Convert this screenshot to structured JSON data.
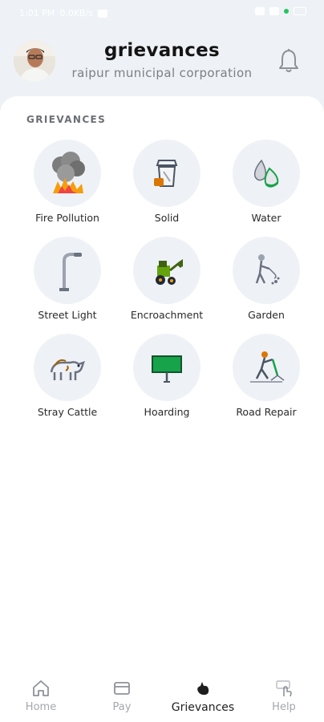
{
  "status_bar": {
    "time": "1:01 PM",
    "carrier": "0.0KB/s"
  },
  "header": {
    "title": "grievances",
    "subtitle": "raipur municipal corporation",
    "bell_icon": "bell-icon",
    "avatar": "user-avatar"
  },
  "section": {
    "title": "GRIEVANCES"
  },
  "categories": [
    {
      "label": "Fire Pollution",
      "icon": "fire-pollution-icon"
    },
    {
      "label": "Solid",
      "icon": "solid-waste-icon"
    },
    {
      "label": "Water",
      "icon": "water-icon"
    },
    {
      "label": "Street Light",
      "icon": "street-light-icon"
    },
    {
      "label": "Encroachment",
      "icon": "encroachment-icon"
    },
    {
      "label": "Garden",
      "icon": "garden-icon"
    },
    {
      "label": "Stray Cattle",
      "icon": "stray-cattle-icon"
    },
    {
      "label": "Hoarding",
      "icon": "hoarding-icon"
    },
    {
      "label": "Road Repair",
      "icon": "road-repair-icon"
    }
  ],
  "bottom_nav": [
    {
      "label": "Home",
      "icon": "home-icon",
      "active": false
    },
    {
      "label": "Pay",
      "icon": "card-icon",
      "active": false
    },
    {
      "label": "Grievances",
      "icon": "grievances-icon",
      "active": true
    },
    {
      "label": "Help",
      "icon": "help-icon",
      "active": false
    }
  ],
  "colors": {
    "background": "#eef2f6",
    "card": "#ffffff",
    "active_nav": "#1e1e1e",
    "inactive_nav": "#a3a7ad"
  }
}
